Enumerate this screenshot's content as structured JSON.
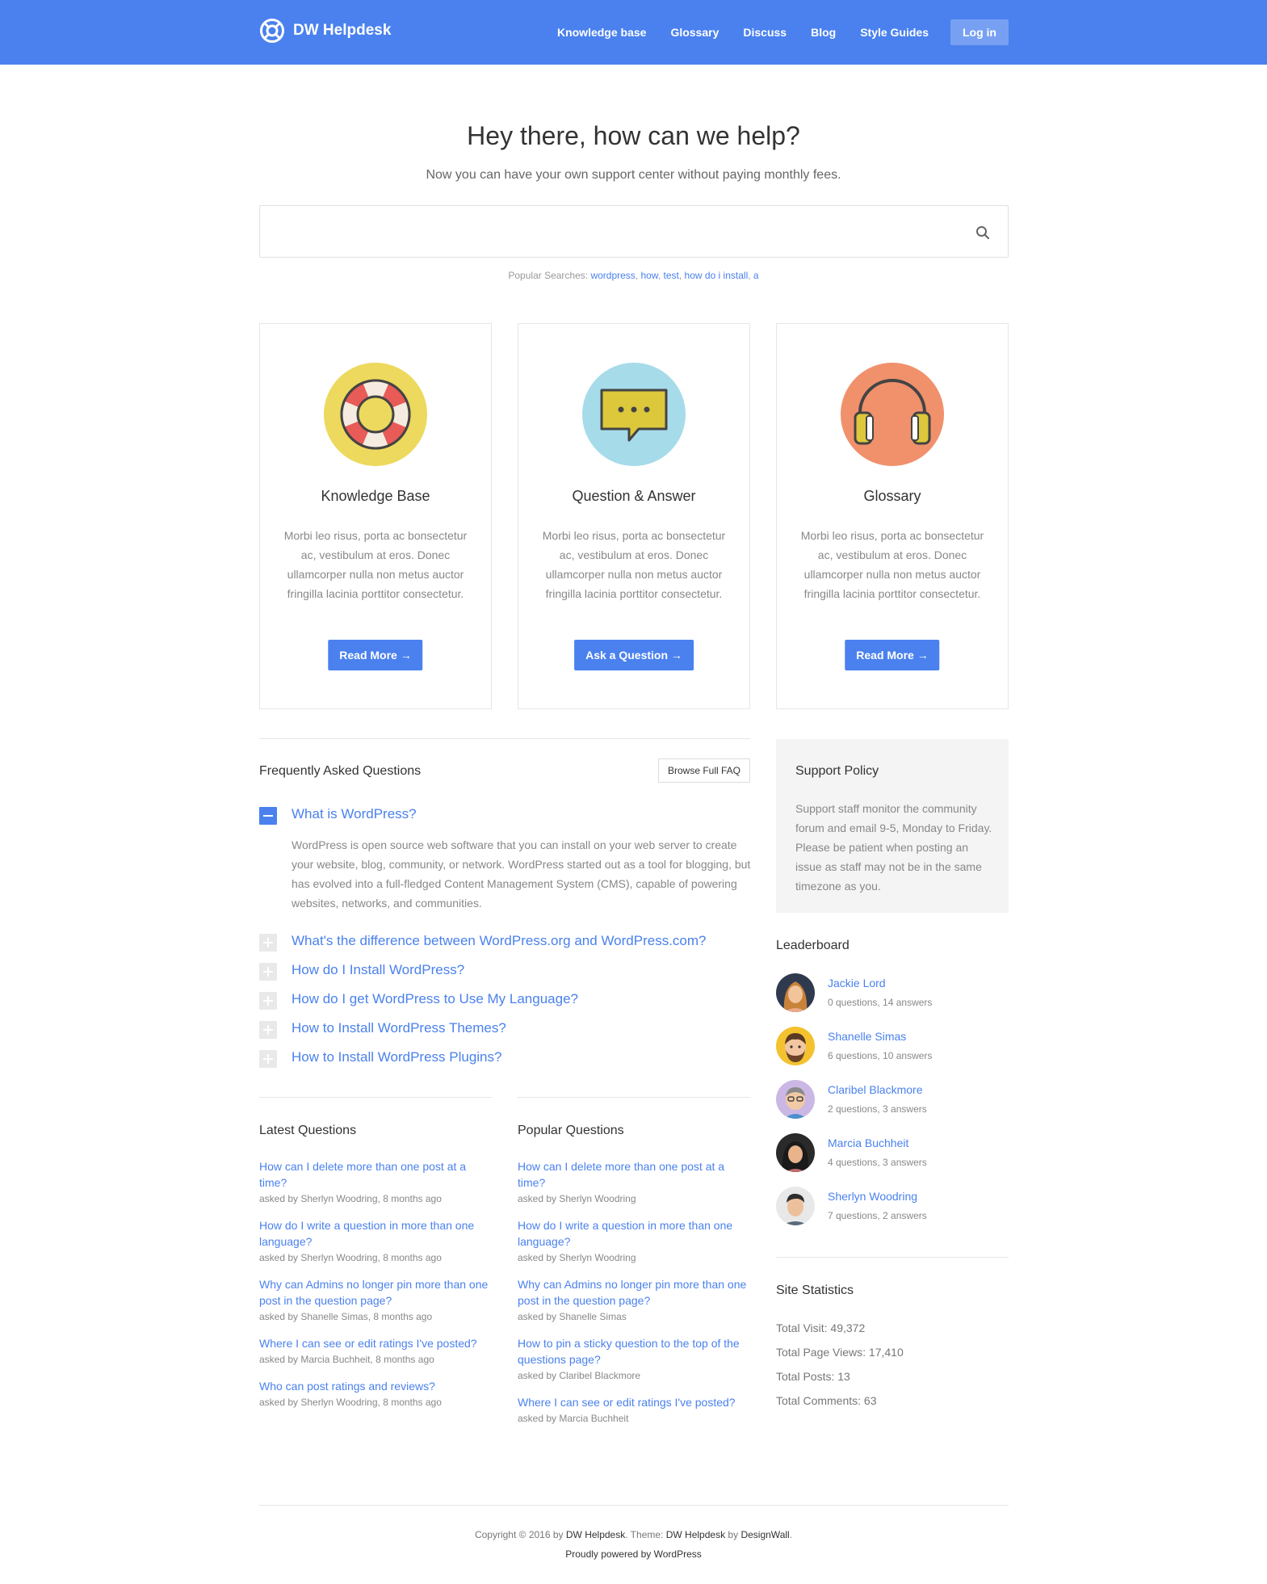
{
  "header": {
    "brand": "DW Helpdesk",
    "nav": [
      "Knowledge base",
      "Glossary",
      "Discuss",
      "Blog",
      "Style Guides"
    ],
    "login": "Log in"
  },
  "hero": {
    "title": "Hey there, how can we help?",
    "subtitle": "Now you can have your own support center without paying monthly fees.",
    "search_placeholder": "",
    "popular_label": "Popular Searches:",
    "popular": [
      "wordpress",
      "how",
      "test",
      "how do i install",
      "a"
    ]
  },
  "cards": [
    {
      "title": "Knowledge Base",
      "text": "Morbi leo risus, porta ac bonsectetur ac, vestibulum at eros. Donec ullamcorper nulla non metus auctor fringilla lacinia porttitor consectetur.",
      "button": "Read More →",
      "icon": "lifebuoy-icon"
    },
    {
      "title": "Question & Answer",
      "text": "Morbi leo risus, porta ac bonsectetur ac, vestibulum at eros. Donec ullamcorper nulla non metus auctor fringilla lacinia porttitor consectetur.",
      "button": "Ask a Question →",
      "icon": "chat-bubble-icon"
    },
    {
      "title": "Glossary",
      "text": "Morbi leo risus, porta ac bonsectetur ac, vestibulum at eros. Donec ullamcorper nulla non metus auctor fringilla lacinia porttitor consectetur.",
      "button": "Read More →",
      "icon": "headphones-icon"
    }
  ],
  "faq": {
    "title": "Frequently Asked Questions",
    "browse": "Browse Full FAQ",
    "open_question": "What is WordPress?",
    "open_answer": "WordPress is open source web software that you can install on your web server to create your website, blog, community, or network. WordPress started out as a tool for blogging, but has evolved into a full-fledged Content Management System (CMS), capable of powering websites, networks, and communities.",
    "questions": [
      "What's the difference between WordPress.org and WordPress.com?",
      "How do I Install WordPress?",
      "How do I get WordPress to Use My Language?",
      "How to Install WordPress Themes?",
      "How to Install WordPress Plugins?"
    ]
  },
  "policy": {
    "title": "Support Policy",
    "text": "Support staff monitor the community forum and email 9-5, Monday to Friday. Please be patient when posting an issue as staff may not be in the same timezone as you."
  },
  "leaderboard": {
    "title": "Leaderboard",
    "users": [
      {
        "name": "Jackie Lord",
        "stats": "0 questions, 14 answers"
      },
      {
        "name": "Shanelle Simas",
        "stats": "6 questions, 10 answers"
      },
      {
        "name": "Claribel Blackmore",
        "stats": "2 questions, 3 answers"
      },
      {
        "name": "Marcia Buchheit",
        "stats": "4 questions, 3 answers"
      },
      {
        "name": "Sherlyn Woodring",
        "stats": "7 questions, 2 answers"
      }
    ]
  },
  "latest": {
    "title": "Latest Questions",
    "items": [
      {
        "q": "How can I delete more than one post at a time?",
        "meta": "asked by Sherlyn Woodring, 8 months ago"
      },
      {
        "q": "How do I write a question in more than one language?",
        "meta": "asked by Sherlyn Woodring, 8 months ago"
      },
      {
        "q": "Why can Admins no longer pin more than one post in the question page?",
        "meta": "asked by Shanelle Simas, 8 months ago"
      },
      {
        "q": "Where I can see or edit ratings I've posted?",
        "meta": "asked by Marcia Buchheit, 8 months ago"
      },
      {
        "q": "Who can post ratings and reviews?",
        "meta": "asked by Sherlyn Woodring, 8 months ago"
      }
    ]
  },
  "popular_q": {
    "title": "Popular Questions",
    "items": [
      {
        "q": "How can I delete more than one post at a time?",
        "meta": "asked by Sherlyn Woodring"
      },
      {
        "q": "How do I write a question in more than one language?",
        "meta": "asked by Sherlyn Woodring"
      },
      {
        "q": "Why can Admins no longer pin more than one post in the question page?",
        "meta": "asked by Shanelle Simas"
      },
      {
        "q": "How to pin a sticky question to the top of the questions page?",
        "meta": "asked by Claribel Blackmore"
      },
      {
        "q": "Where I can see or edit ratings I've posted?",
        "meta": "asked by Marcia Buchheit"
      }
    ]
  },
  "stats": {
    "title": "Site Statistics",
    "items": [
      "Total Visit: 49,372",
      "Total Page Views: 17,410",
      "Total Posts: 13",
      "Total Comments: 63"
    ]
  },
  "footer": {
    "c1": "Copyright © 2016 by",
    "c2": "DW Helpdesk",
    "c3": ". Theme:",
    "c4": "DW Helpdesk",
    "c5": "by",
    "c6": "DesignWall",
    "c7": ".",
    "powered": "Proudly powered by WordPress"
  },
  "colors": {
    "accent": "#4a81ee"
  }
}
